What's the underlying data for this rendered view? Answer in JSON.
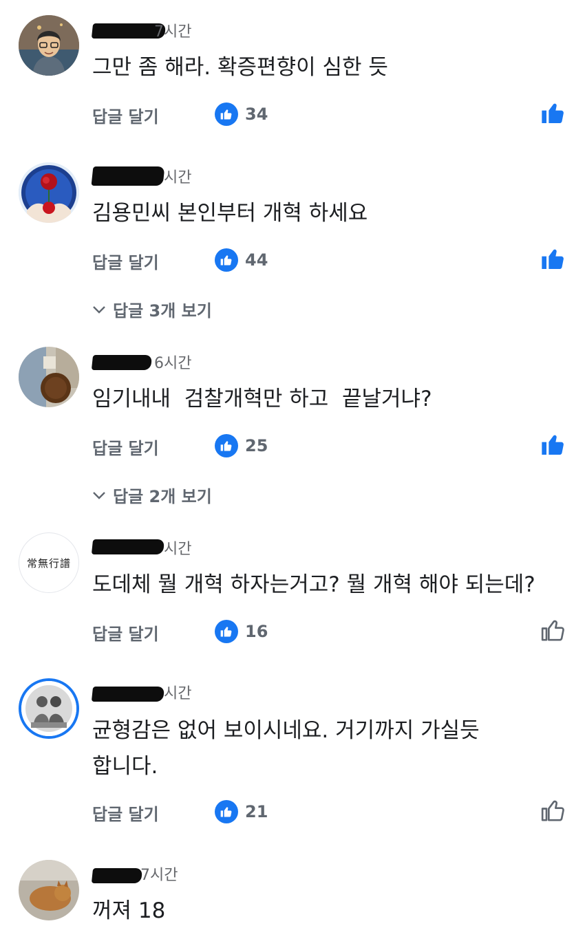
{
  "comments": [
    {
      "time": "7시간",
      "text_lines": [
        "그만 좀 해라. 확증편향이 심한 듯"
      ],
      "reply_label": "답글 달기",
      "like_count": "34",
      "liked": true,
      "avatar_icon": "illustrated-man-avatar"
    },
    {
      "time": "시간",
      "text_lines": [
        "김용민씨 본인부터 개혁 하세요"
      ],
      "reply_label": "답글 달기",
      "like_count": "44",
      "liked": true,
      "replies_label": "답글 3개 보기",
      "avatar_icon": "rose-hands-avatar"
    },
    {
      "time": "6시간",
      "text_lines": [
        "임기내내  검찰개혁만 하고  끝날거냐?"
      ],
      "reply_label": "답글 달기",
      "like_count": "25",
      "liked": true,
      "replies_label": "답글 2개 보기",
      "avatar_icon": "photo-avatar"
    },
    {
      "time": "시간",
      "text_lines": [
        "도데체 뭘 개혁 하자는거고? 뭘 개혁 해야 되는데?"
      ],
      "reply_label": "답글 달기",
      "like_count": "16",
      "liked": false,
      "avatar_icon": "calligraphy-avatar",
      "avatar_text": "常無行譜"
    },
    {
      "time": "시간",
      "text_lines": [
        "균형감은 없어 보이시네요. 거기까지 가실듯",
        "합니다."
      ],
      "reply_label": "답글 달기",
      "like_count": "21",
      "liked": false,
      "avatar_icon": "children-photo-avatar"
    },
    {
      "time": "7시간",
      "text_lines": [
        "꺼져 18"
      ],
      "avatar_icon": "cat-photo-avatar"
    }
  ],
  "colors": {
    "accent": "#1877f2",
    "secondary_text": "#65676b",
    "action_text": "#606770"
  }
}
